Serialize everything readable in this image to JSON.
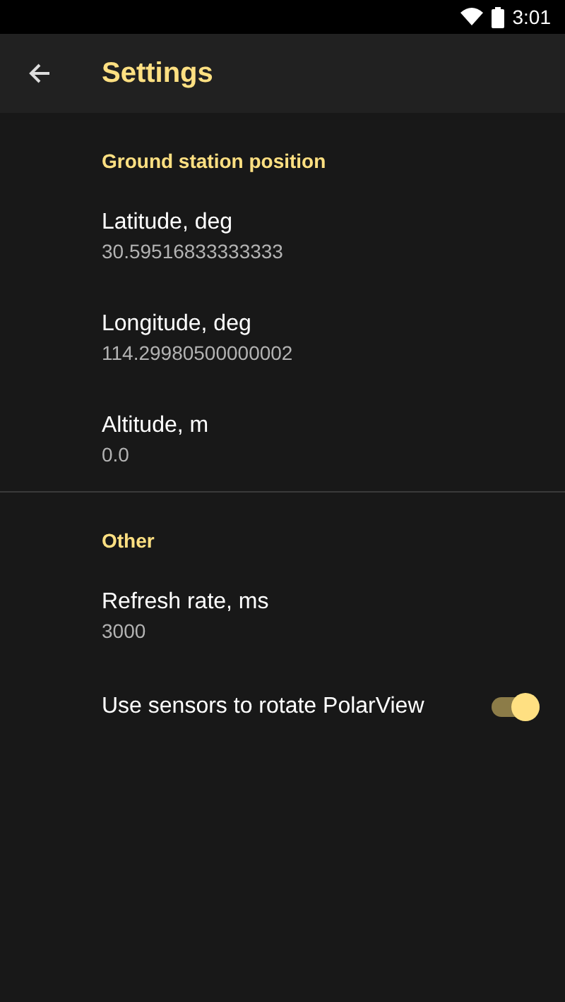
{
  "status_bar": {
    "time": "3:01"
  },
  "toolbar": {
    "title": "Settings"
  },
  "categories": [
    {
      "title": "Ground station position",
      "items": [
        {
          "kind": "text",
          "title": "Latitude, deg",
          "summary": "30.59516833333333"
        },
        {
          "kind": "text",
          "title": "Longitude, deg",
          "summary": "114.29980500000002"
        },
        {
          "kind": "text",
          "title": "Altitude, m",
          "summary": "0.0"
        }
      ]
    },
    {
      "title": "Other",
      "items": [
        {
          "kind": "text",
          "title": "Refresh rate, ms",
          "summary": "3000"
        },
        {
          "kind": "switch",
          "title": "Use sensors to rotate PolarView",
          "on": true
        }
      ]
    }
  ]
}
